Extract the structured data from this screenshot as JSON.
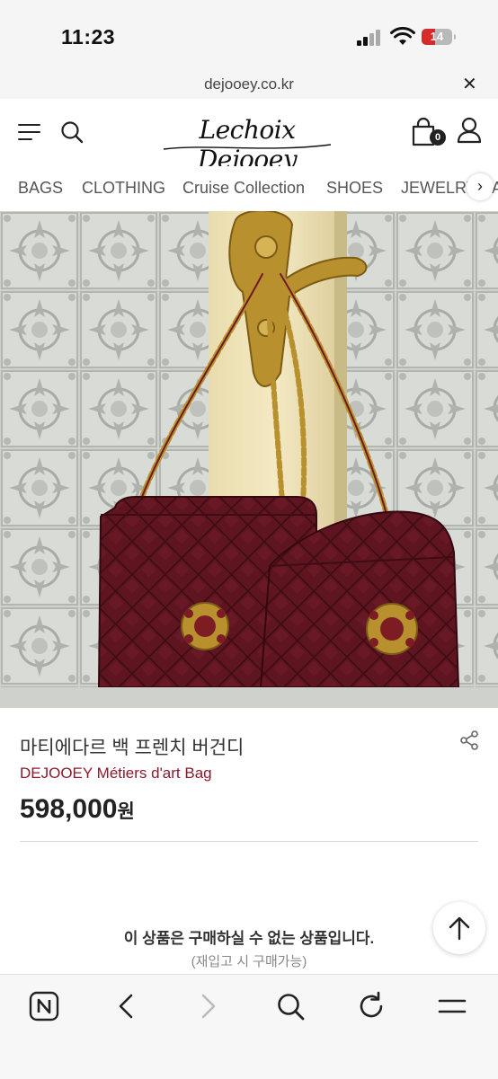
{
  "status_bar": {
    "time": "11:23",
    "battery": "14"
  },
  "browser": {
    "url": "dejooey.co.kr"
  },
  "header": {
    "logo": "Lechoix Dejooey",
    "cart_count": "0"
  },
  "categories": [
    "BAGS",
    "CLOTHING",
    "Cruise Collection",
    "SHOES",
    "JEWELRY",
    "A"
  ],
  "product": {
    "name": "마티에다르 백 프렌치 버건디",
    "brand_name": "DEJOOEY Métiers d'art Bag",
    "price": "598,000",
    "currency": "원"
  },
  "availability": {
    "message": "이 상품은 구매하실 수 없는 상품입니다.",
    "note": "(재입고 시 구매가능)"
  },
  "icons": {
    "menu": "hamburger-menu-icon",
    "search": "search-icon",
    "cart": "shopping-bag-icon",
    "user": "user-icon",
    "share": "share-icon",
    "scroll_top": "arrow-up-icon",
    "toolbar": [
      "naver-home-icon",
      "back-icon",
      "forward-icon",
      "search-icon",
      "reload-icon",
      "menu-icon"
    ]
  },
  "colors": {
    "brand_accent": "#8a1a2b",
    "bag_burgundy": "#5e1520",
    "chain_gold": "#b8902e"
  }
}
